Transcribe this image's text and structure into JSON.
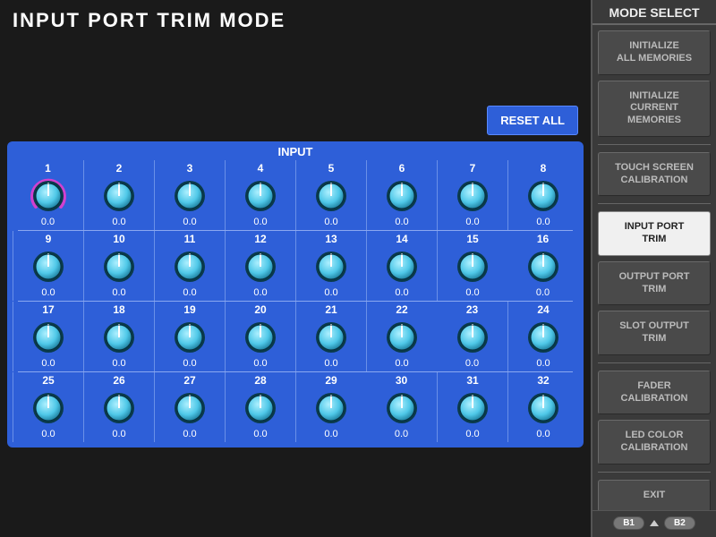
{
  "title": "INPUT PORT TRIM MODE",
  "reset_label": "RESET ALL",
  "input_panel": {
    "header": "INPUT",
    "knobs": [
      {
        "n": "1",
        "v": "0.0",
        "selected": true
      },
      {
        "n": "2",
        "v": "0.0"
      },
      {
        "n": "3",
        "v": "0.0"
      },
      {
        "n": "4",
        "v": "0.0"
      },
      {
        "n": "5",
        "v": "0.0"
      },
      {
        "n": "6",
        "v": "0.0"
      },
      {
        "n": "7",
        "v": "0.0"
      },
      {
        "n": "8",
        "v": "0.0"
      },
      {
        "n": "9",
        "v": "0.0"
      },
      {
        "n": "10",
        "v": "0.0"
      },
      {
        "n": "11",
        "v": "0.0"
      },
      {
        "n": "12",
        "v": "0.0"
      },
      {
        "n": "13",
        "v": "0.0"
      },
      {
        "n": "14",
        "v": "0.0"
      },
      {
        "n": "15",
        "v": "0.0"
      },
      {
        "n": "16",
        "v": "0.0"
      },
      {
        "n": "17",
        "v": "0.0"
      },
      {
        "n": "18",
        "v": "0.0"
      },
      {
        "n": "19",
        "v": "0.0"
      },
      {
        "n": "20",
        "v": "0.0"
      },
      {
        "n": "21",
        "v": "0.0"
      },
      {
        "n": "22",
        "v": "0.0"
      },
      {
        "n": "23",
        "v": "0.0"
      },
      {
        "n": "24",
        "v": "0.0"
      },
      {
        "n": "25",
        "v": "0.0"
      },
      {
        "n": "26",
        "v": "0.0"
      },
      {
        "n": "27",
        "v": "0.0"
      },
      {
        "n": "28",
        "v": "0.0"
      },
      {
        "n": "29",
        "v": "0.0"
      },
      {
        "n": "30",
        "v": "0.0"
      },
      {
        "n": "31",
        "v": "0.0"
      },
      {
        "n": "32",
        "v": "0.0"
      }
    ]
  },
  "sidebar": {
    "title": "MODE SELECT",
    "groups": [
      [
        "INITIALIZE\nALL MEMORIES",
        "INITIALIZE\nCURRENT MEMORIES"
      ],
      [
        "TOUCH SCREEN\nCALIBRATION"
      ],
      [
        "INPUT PORT\nTRIM",
        "OUTPUT PORT\nTRIM",
        "SLOT OUTPUT\nTRIM"
      ],
      [
        "FADER\nCALIBRATION",
        "LED COLOR\nCALIBRATION"
      ],
      [
        "EXIT"
      ]
    ],
    "selected": "INPUT PORT\nTRIM",
    "nav": {
      "left": "B1",
      "right": "B2"
    }
  },
  "colors": {
    "knob_face": "#4fc8e8",
    "knob_dark": "#0a3a4a",
    "panel_blue": "#2e5fd8"
  }
}
